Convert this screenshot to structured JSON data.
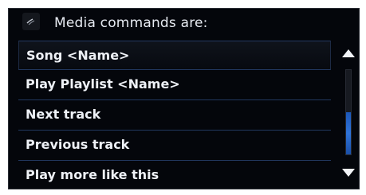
{
  "header": {
    "title": "Media commands are:",
    "icon": "voice-icon"
  },
  "commands": [
    {
      "label": "Song <Name>"
    },
    {
      "label": "Play Playlist <Name>"
    },
    {
      "label": "Next track"
    },
    {
      "label": "Previous track"
    },
    {
      "label": "Play more like this"
    }
  ],
  "scrollbar": {
    "up_icon": "arrow-up-icon",
    "down_icon": "arrow-down-icon",
    "thumb_start_fraction": 0.5,
    "thumb_size_fraction": 0.5,
    "thumb_color": "#2f73d8"
  },
  "colors": {
    "background": "#04060b",
    "text": "#eef1f6",
    "divider": "#223860",
    "accent": "#2f73d8"
  }
}
